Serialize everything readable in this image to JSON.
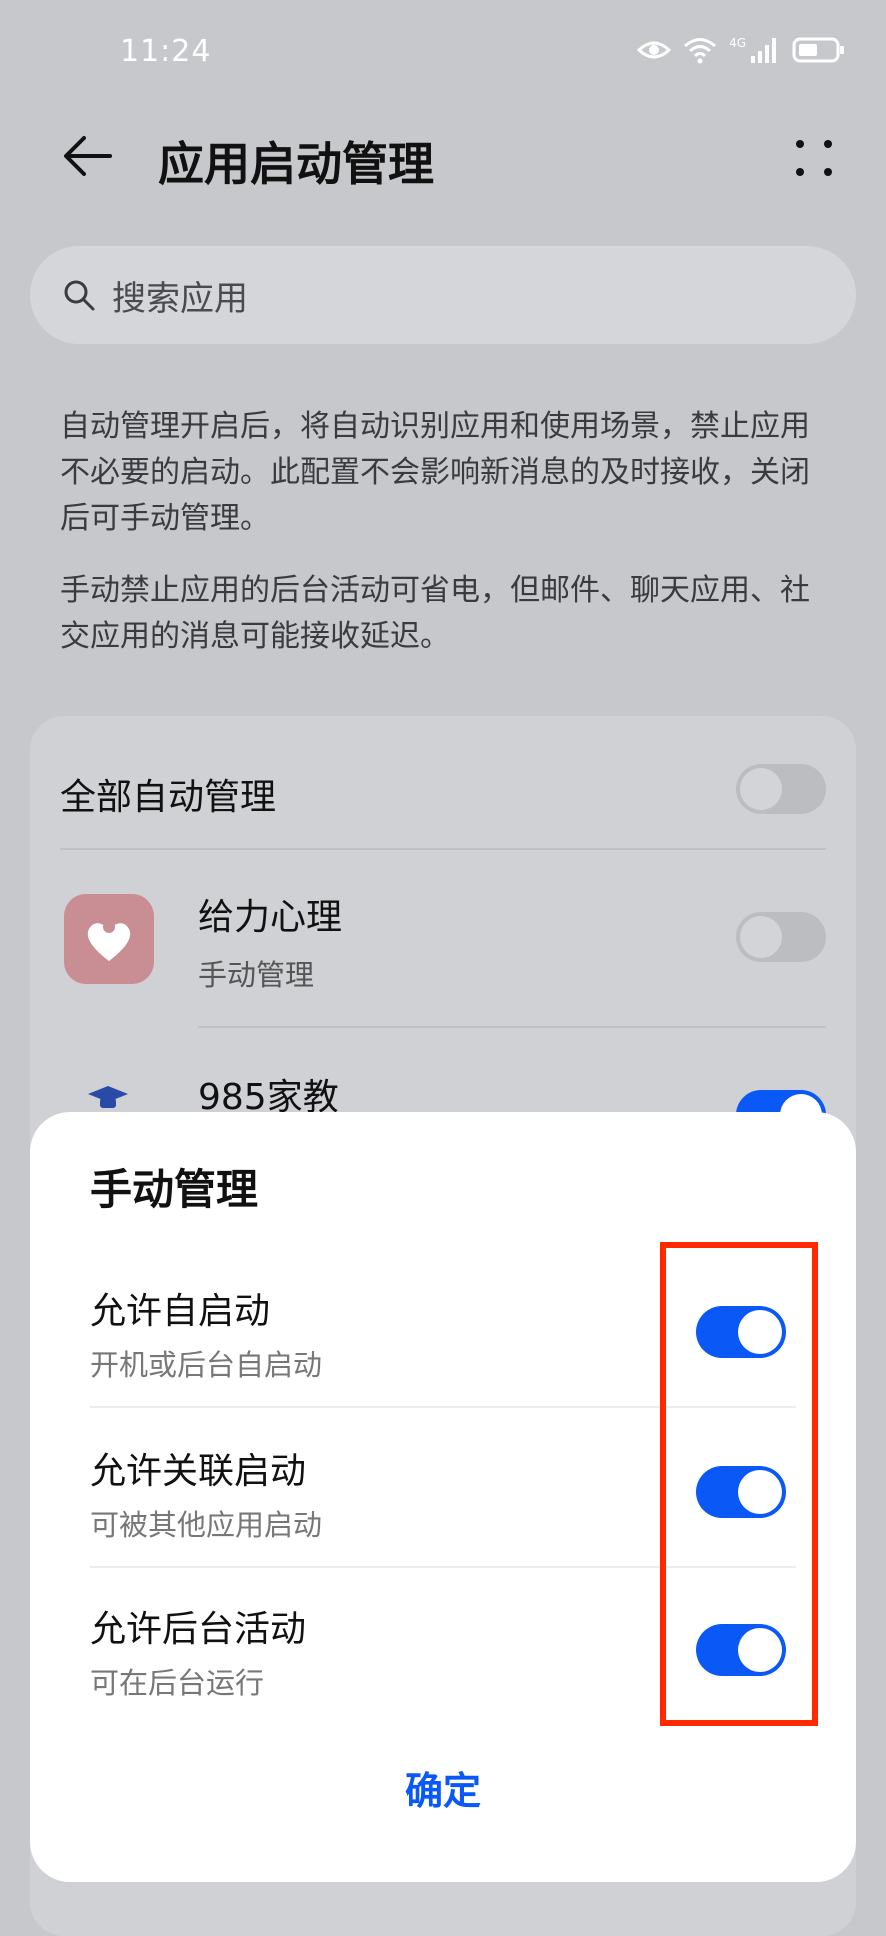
{
  "status_bar": {
    "time": "11:24",
    "network_label": "4G",
    "icons": [
      "eye-icon",
      "wifi-icon",
      "signal-icon",
      "battery-icon"
    ]
  },
  "header": {
    "title": "应用启动管理",
    "back_icon": "arrow-left-icon",
    "more_icon": "more-dots-icon"
  },
  "search": {
    "placeholder": "搜索应用",
    "icon": "search-icon"
  },
  "description": {
    "para1": "自动管理开启后，将自动识别应用和使用场景，禁止应用不必要的启动。此配置不会影响新消息的及时接收，关闭后可手动管理。",
    "para2": "手动禁止应用的后台活动可省电，但邮件、聊天应用、社交应用的消息可能接收延迟。"
  },
  "list": {
    "all_auto": {
      "label": "全部自动管理",
      "on": false
    },
    "apps": [
      {
        "name": "给力心理",
        "status": "手动管理",
        "on": false
      },
      {
        "name": "985家教",
        "status": "",
        "on": true
      }
    ]
  },
  "dialog": {
    "title": "手动管理",
    "options": [
      {
        "label": "允许自启动",
        "sub": "开机或后台自启动",
        "on": true
      },
      {
        "label": "允许关联启动",
        "sub": "可被其他应用启动",
        "on": true
      },
      {
        "label": "允许后台活动",
        "sub": "可在后台运行",
        "on": true
      }
    ],
    "confirm": "确定"
  },
  "colors": {
    "accent": "#0a59f7",
    "highlight": "#ff2a00"
  }
}
